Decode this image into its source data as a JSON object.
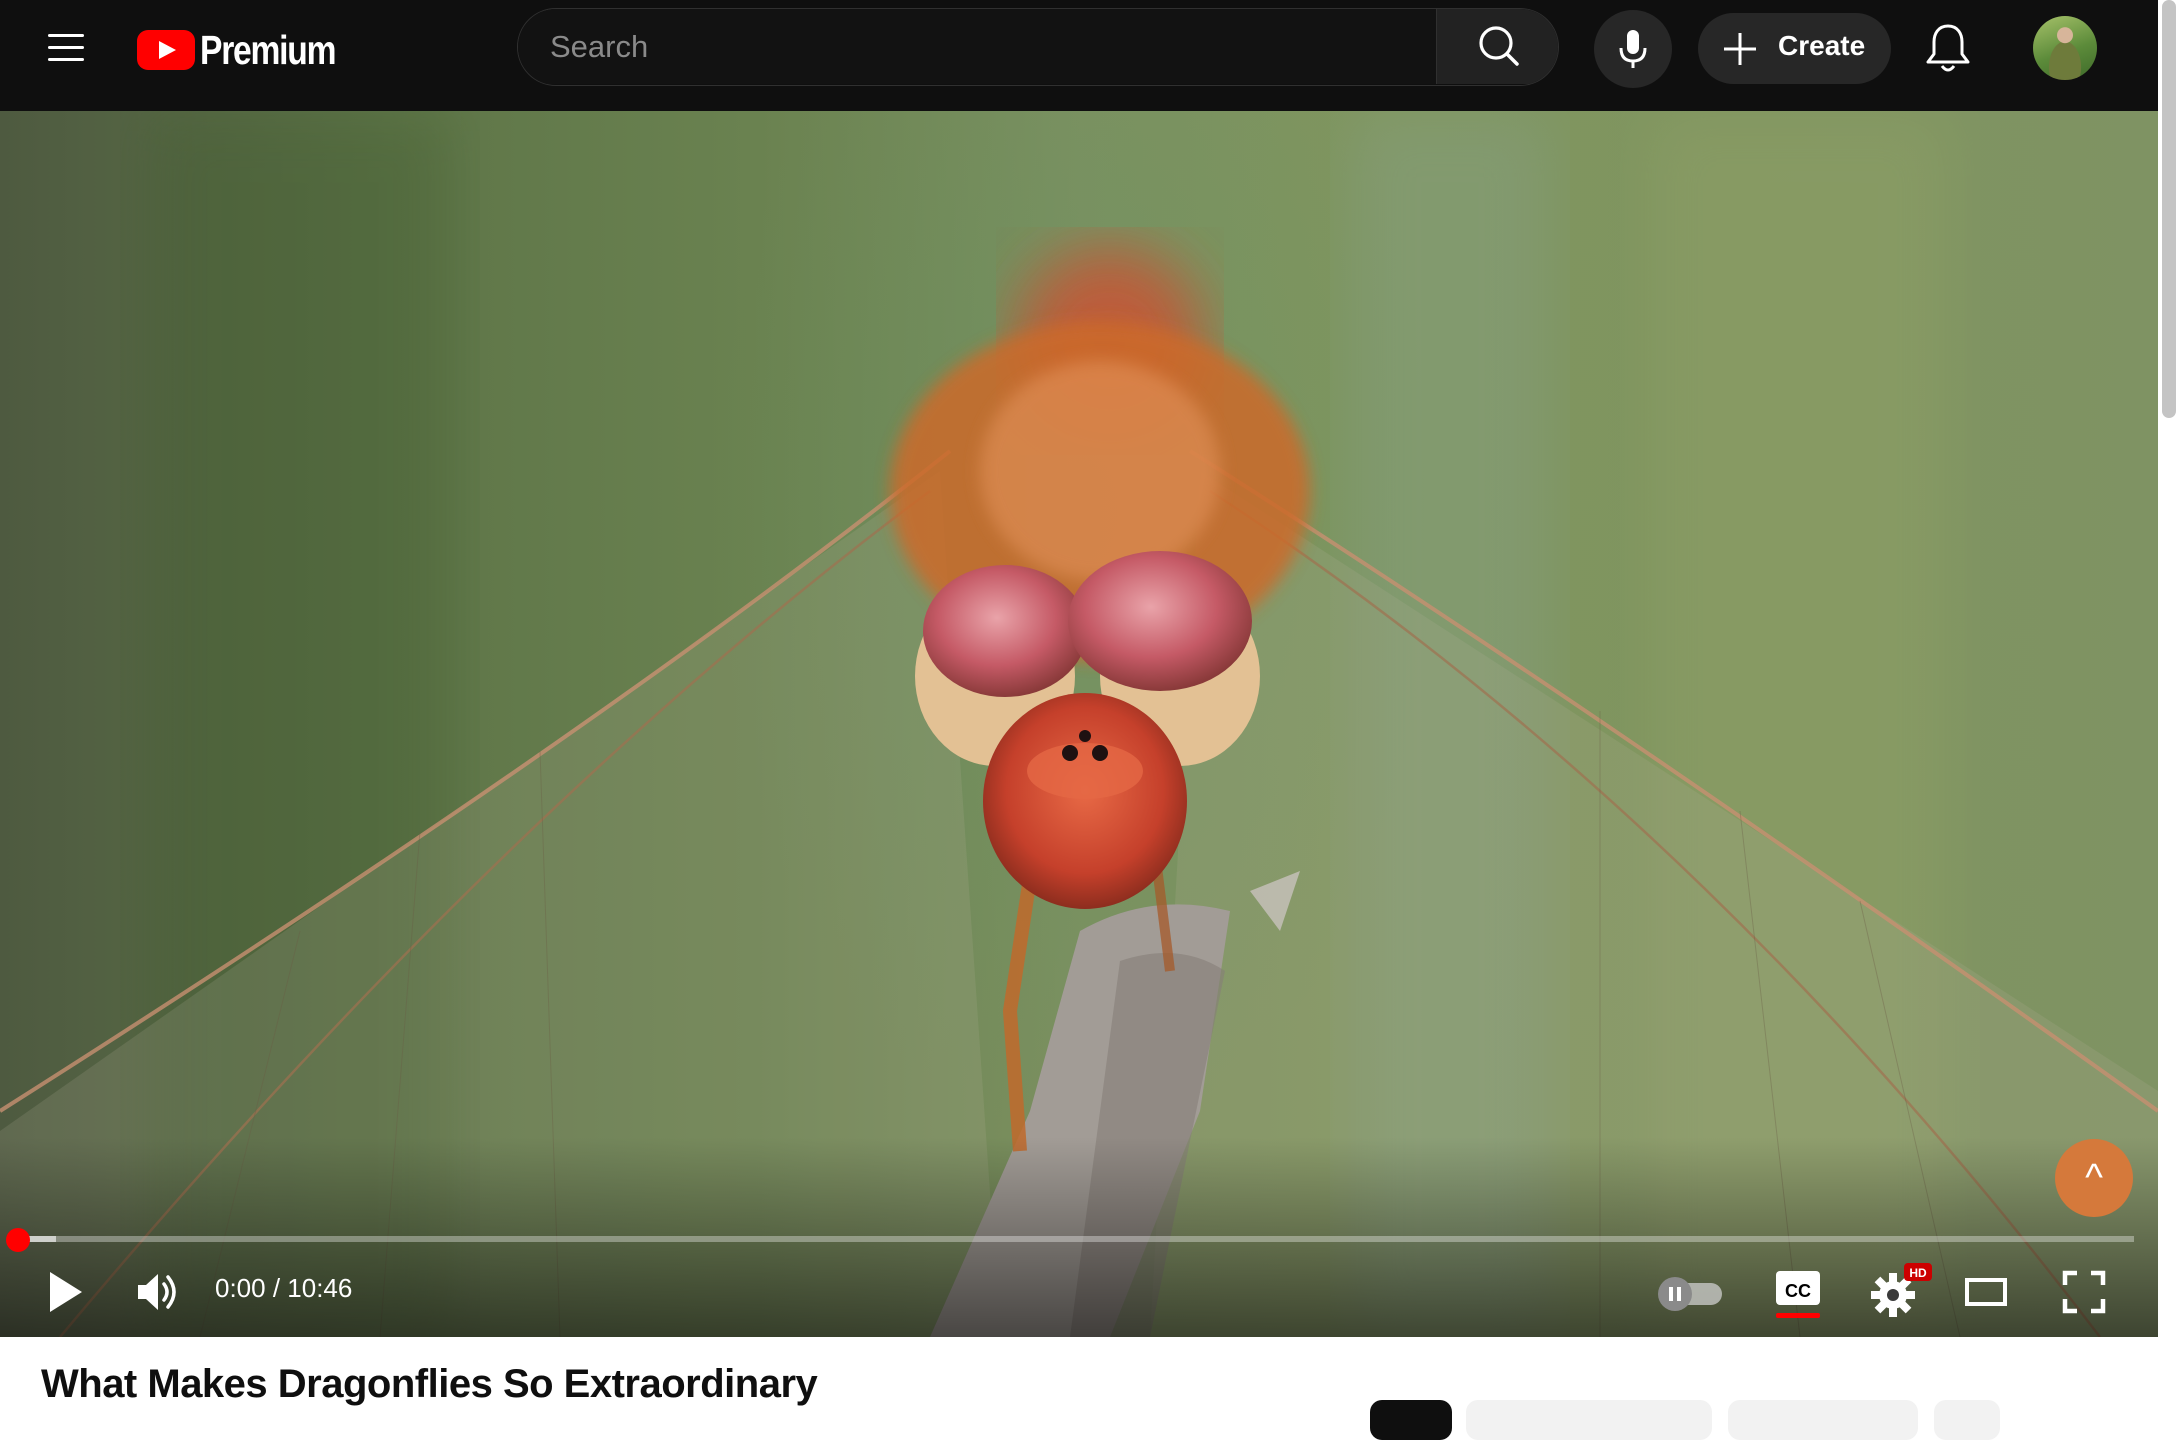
{
  "header": {
    "logo_text": "Premium",
    "search_placeholder": "Search",
    "create_label": "Create"
  },
  "player": {
    "time_display": "0:00 / 10:46",
    "hd_badge": "HD",
    "progress_played_fraction": 0.0,
    "progress_buffered_fraction": 0.018
  },
  "video": {
    "title": "What Makes Dragonflies So Extraordinary"
  },
  "chips": [
    {
      "label": "",
      "active": true
    },
    {
      "label": "",
      "active": false
    },
    {
      "label": "",
      "active": false
    },
    {
      "label": "",
      "active": false
    }
  ],
  "colors": {
    "header_bg": "#0f0f0f",
    "accent_red": "#ff0000",
    "fab_orange": "#d5793b"
  },
  "icons": [
    "menu-icon",
    "youtube-logo-icon",
    "search-icon",
    "microphone-icon",
    "plus-icon",
    "bell-icon",
    "play-icon",
    "volume-icon",
    "autoplay-toggle-icon",
    "captions-icon",
    "settings-icon",
    "theater-mode-icon",
    "fullscreen-icon",
    "caret-up-icon"
  ]
}
